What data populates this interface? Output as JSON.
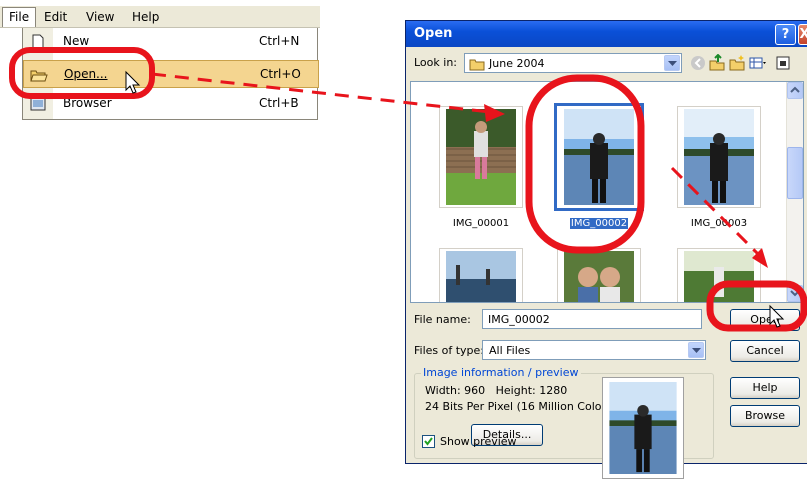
{
  "menubar": {
    "items": [
      "File",
      "Edit",
      "View",
      "Help"
    ]
  },
  "file_menu": {
    "items": [
      {
        "label": "New",
        "accel": "Ctrl+N",
        "icon": "new-document-icon"
      },
      {
        "label": "Open...",
        "accel": "Ctrl+O",
        "icon": "open-folder-icon"
      },
      {
        "label": "Browser",
        "accel": "Ctrl+B",
        "icon": "browser-icon"
      }
    ]
  },
  "dialog": {
    "title": "Open",
    "help_btn": "?",
    "close_btn": "X",
    "look_in_label": "Look in:",
    "look_in_value": "June 2004",
    "files": [
      {
        "name": "IMG_00001",
        "selected": false
      },
      {
        "name": "IMG_00002",
        "selected": true
      },
      {
        "name": "IMG_00003",
        "selected": false
      }
    ],
    "file_name_label": "File name:",
    "file_name_value": "IMG_00002",
    "files_of_type_label": "Files of type:",
    "files_of_type_value": "All Files",
    "open_btn": "Open",
    "cancel_btn": "Cancel",
    "help_button": "Help",
    "browse_btn": "Browse",
    "info_title": "Image information / preview",
    "info_dims": "Width: 960   Height: 1280",
    "info_bits": "24 Bits Per Pixel (16 Million Colors)",
    "details_btn": "Details...",
    "show_preview_label": "Show preview",
    "show_preview_checked": true
  },
  "colors": {
    "highlight_circle": "#e8141c",
    "selection": "#316ac5",
    "titlebar": "#0a50d8"
  }
}
